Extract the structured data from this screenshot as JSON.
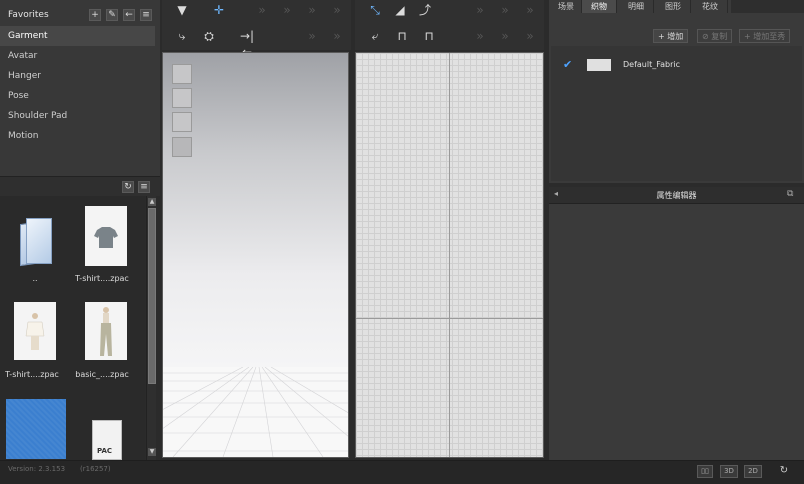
{
  "sidebar": {
    "header": "Favorites",
    "items": [
      "Garment",
      "Avatar",
      "Hanger",
      "Pose",
      "Shoulder Pad",
      "Motion"
    ],
    "active_index": 0
  },
  "library": {
    "items": [
      {
        "label": "..",
        "icon": "folder-icon"
      },
      {
        "label": "T-shirt....zpac",
        "icon": "tshirt-thumbnail"
      },
      {
        "label": "T-shirt....zpac",
        "icon": "tshirt-avatar-thumbnail"
      },
      {
        "label": "basic_....zpac",
        "icon": "pants-avatar-thumbnail"
      },
      {
        "label": "",
        "icon": "blue-fabric-thumbnail"
      },
      {
        "label": "PAC",
        "icon": "pac-file-icon"
      }
    ]
  },
  "right_panel": {
    "tabs": [
      "场景",
      "织物",
      "明细",
      "图形",
      "花纹"
    ],
    "active_tab": 1,
    "buttons": {
      "add": "增加",
      "copy": "复制",
      "add_to_obj": "增加至秀"
    },
    "fabric_list": [
      {
        "name": "Default_Fabric",
        "checked": true,
        "swatch": "#e0e0e0"
      }
    ],
    "property_editor_title": "属性编辑器"
  },
  "status": {
    "version": "Version: 2.3.153",
    "build": "(r16257)"
  },
  "colors": {
    "accent_blue": "#2e7fd6",
    "check_blue": "#4ea3ff",
    "fabric_thumb_blue": "#3b7fcf"
  }
}
